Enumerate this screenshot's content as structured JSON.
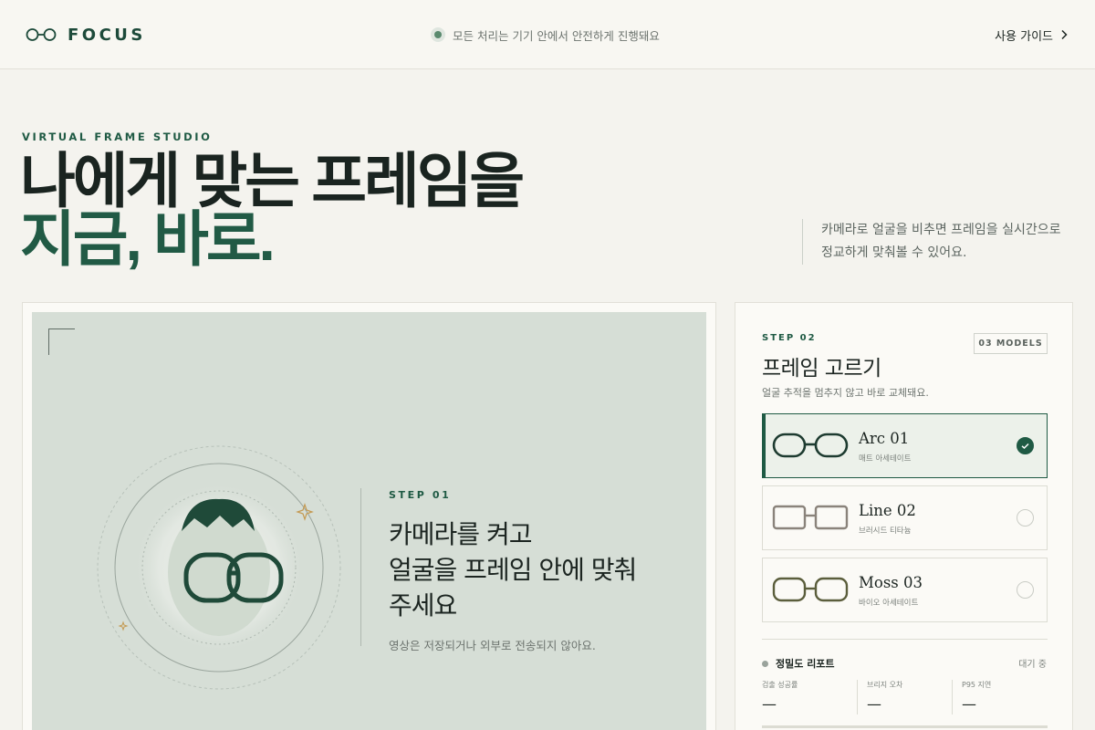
{
  "header": {
    "brand": "FOCUS",
    "status_text": "모든 처리는 기기 안에서 안전하게 진행돼요",
    "guide_label": "사용 가이드"
  },
  "hero": {
    "eyebrow": "VIRTUAL FRAME STUDIO",
    "headline_line1": "나에게 맞는 프레임을",
    "headline_line2": "지금, 바로.",
    "description_line1": "카메라로 얼굴을 비추면 프레임을 실시간으로",
    "description_line2": "정교하게 맞춰볼 수 있어요."
  },
  "stage": {
    "step_label": "STEP 01",
    "title_line1": "카메라를 켜고",
    "title_line2": "얼굴을 프레임 안에 맞춰",
    "title_line3": "주세요",
    "note": "영상은 저장되거나 외부로 전송되지 않아요."
  },
  "panel": {
    "step_label": "STEP 02",
    "models_badge": "03 MODELS",
    "title": "프레임 고르기",
    "subtitle": "얼굴 추적을 멈추지 않고 바로 교체돼요.",
    "frames": [
      {
        "name": "Arc 01",
        "material": "매트 아세테이트",
        "selected": true,
        "color": "#1d3b30"
      },
      {
        "name": "Line 02",
        "material": "브러시드 티타늄",
        "selected": false,
        "color": "#8a837b"
      },
      {
        "name": "Moss 03",
        "material": "바이오 아세테이트",
        "selected": false,
        "color": "#5b5e3c"
      }
    ],
    "report": {
      "title": "정밀도 리포트",
      "status": "대기 중",
      "metrics": [
        {
          "label": "검출 성공률",
          "value": "—"
        },
        {
          "label": "브리지 오차",
          "value": "—"
        },
        {
          "label": "P95 지연",
          "value": "—"
        }
      ]
    }
  },
  "colors": {
    "accent": "#1f5a44",
    "background": "#f4f3ee",
    "stage": "#d6ded6"
  }
}
